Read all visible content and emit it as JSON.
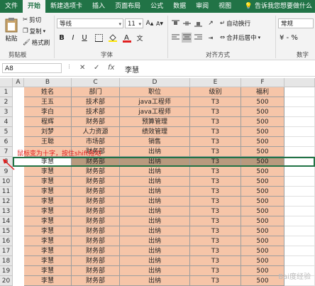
{
  "tabs": [
    "文件",
    "开始",
    "新建选项卡",
    "插入",
    "页面布局",
    "公式",
    "数据",
    "审阅",
    "视图"
  ],
  "active_tab": "开始",
  "tell_me": "告诉我您想要做什么",
  "ribbon": {
    "clipboard": {
      "paste": "粘贴",
      "cut": "剪切",
      "copy": "复制",
      "format_painter": "格式刷",
      "label": "剪贴板"
    },
    "font": {
      "name": "等线",
      "size": "11",
      "label": "字体",
      "bold": "B",
      "italic": "I",
      "underline": "U",
      "grow": "A",
      "shrink": "A"
    },
    "alignment": {
      "wrap": "自动换行",
      "merge": "合并后居中",
      "label": "对齐方式"
    },
    "number": {
      "format": "常规",
      "label": "数字"
    }
  },
  "formula_bar": {
    "name_box": "A8",
    "cancel": "✕",
    "enter": "✓",
    "fx": "fx",
    "content": "李慧"
  },
  "columns": [
    "A",
    "B",
    "C",
    "D",
    "E",
    "F"
  ],
  "header_row": [
    "姓名",
    "部门",
    "职位",
    "级别",
    "福利"
  ],
  "rows": [
    [
      "王五",
      "技术部",
      "java工程师",
      "T3",
      "500"
    ],
    [
      "李白",
      "技术部",
      "java工程师",
      "T3",
      "500"
    ],
    [
      "程辉",
      "财务部",
      "预算管理",
      "T3",
      "500"
    ],
    [
      "刘梦",
      "人力资源",
      "绩效管理",
      "T3",
      "500"
    ],
    [
      "王聪",
      "市场部",
      "销售",
      "T3",
      "500"
    ],
    [
      "",
      "财务部",
      "出纳",
      "T3",
      "500"
    ],
    [
      "李慧",
      "财务部",
      "出纳",
      "T3",
      "500"
    ],
    [
      "李慧",
      "财务部",
      "出纳",
      "T3",
      "500"
    ],
    [
      "李慧",
      "财务部",
      "出纳",
      "T3",
      "500"
    ],
    [
      "李慧",
      "财务部",
      "出纳",
      "T3",
      "500"
    ],
    [
      "李慧",
      "财务部",
      "出纳",
      "T3",
      "500"
    ],
    [
      "李慧",
      "财务部",
      "出纳",
      "T3",
      "500"
    ],
    [
      "李慧",
      "财务部",
      "出纳",
      "T3",
      "500"
    ],
    [
      "李慧",
      "财务部",
      "出纳",
      "T3",
      "500"
    ],
    [
      "李慧",
      "财务部",
      "出纳",
      "T3",
      "500"
    ],
    [
      "李慧",
      "财务部",
      "出纳",
      "T3",
      "500"
    ],
    [
      "李慧",
      "财务部",
      "出纳",
      "T3",
      "500"
    ],
    [
      "李慧",
      "财务部",
      "出纳",
      "T3",
      "500"
    ],
    [
      "李慧",
      "财务部",
      "出纳",
      "T3",
      "500"
    ]
  ],
  "row_numbers": [
    "1",
    "2",
    "3",
    "4",
    "5",
    "6",
    "7",
    "8",
    "9",
    "10",
    "11",
    "12",
    "13",
    "14",
    "15",
    "16",
    "17",
    "18",
    "19",
    "20"
  ],
  "selected_row": 8,
  "annotation": "鼠标变为十字，按住shift拖动",
  "watermark": "Bai度经验",
  "colors": {
    "accent": "#217346",
    "fill": "#f6c5a8",
    "selected": "#b89a7e",
    "annotation": "#e02020"
  }
}
